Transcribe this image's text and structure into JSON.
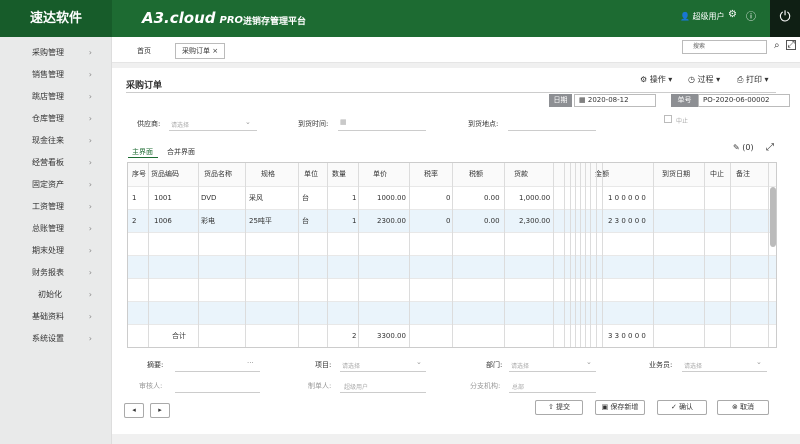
{
  "app": {
    "name": "速达软件",
    "brand": "A3.cloud",
    "edition": "PRO",
    "subtitle": "进销存管理平台",
    "user": "超级用户"
  },
  "icons": {
    "user": "user-icon",
    "settings": "gear-icon",
    "help": "help-icon",
    "power": "power-icon"
  },
  "sidebar": {
    "items": [
      {
        "label": "采购管理"
      },
      {
        "label": "销售管理"
      },
      {
        "label": "跳店管理"
      },
      {
        "label": "仓库管理"
      },
      {
        "label": "现金往来"
      },
      {
        "label": "经营看板"
      },
      {
        "label": "固定资产"
      },
      {
        "label": "工资管理"
      },
      {
        "label": "总账管理"
      },
      {
        "label": "期末处理"
      },
      {
        "label": "财务报表"
      },
      {
        "label": "初始化"
      },
      {
        "label": "基础资料"
      },
      {
        "label": "系统设置"
      }
    ]
  },
  "tabs": [
    {
      "label": "首页"
    },
    {
      "label": "采购订单 ×"
    }
  ],
  "search": {
    "placeholder": "搜索"
  },
  "form": {
    "title": "采购订单",
    "actions": {
      "operate": "操作",
      "process": "过程",
      "print": "打印"
    },
    "date_label": "日期",
    "date_value": "2020-08-12",
    "no_label": "单号",
    "no_value": "PO-2020-06-00002",
    "supplier_label": "供应商:",
    "supplier_placeholder": "请选择",
    "arrival_label": "到货时间:",
    "arrival_place_label": "到货地点:",
    "suspend_label": "中止",
    "sub_tabs": [
      "主界面",
      "合并界面"
    ],
    "attach_count": "(0)"
  },
  "grid": {
    "headers": [
      "序号",
      "货品编码",
      "货品名称",
      "规格",
      "单位",
      "数量",
      "单价",
      "税率",
      "税额",
      "货款",
      "金额",
      "到货日期",
      "中止",
      "备注"
    ],
    "rows": [
      {
        "seq": "1",
        "code": "1001",
        "name": "DVD",
        "spec": "采风",
        "unit": "台",
        "qty": "1",
        "price": "1000.00",
        "rate": "0",
        "tax": "0.00",
        "goods": "1,000.00",
        "amount": "1 0 0 0 0 0"
      },
      {
        "seq": "2",
        "code": "1006",
        "name": "彩电",
        "spec": "25吨平",
        "unit": "台",
        "qty": "1",
        "price": "2300.00",
        "rate": "0",
        "tax": "0.00",
        "goods": "2,300.00",
        "amount": "2 3 0 0 0 0"
      }
    ],
    "total": {
      "label": "合计",
      "qty": "2",
      "price": "3300.00",
      "amount": "3 3 0 0 0 0"
    }
  },
  "footer": {
    "summary_label": "摘要:",
    "summary_more": "···",
    "project_label": "项目:",
    "project_placeholder": "请选择",
    "dept_label": "部门:",
    "dept_placeholder": "请选择",
    "sales_label": "业务员:",
    "sales_placeholder": "请选择",
    "auditor_label": "审核人:",
    "creator_label": "制单人:",
    "creator_value": "超级用户",
    "branch_label": "分支机构:",
    "branch_value": "总部"
  },
  "buttons": {
    "prev": "◂",
    "next": "▸",
    "submit": "提交",
    "save_new": "保存新增",
    "confirm": "确认",
    "cancel": "取消"
  }
}
